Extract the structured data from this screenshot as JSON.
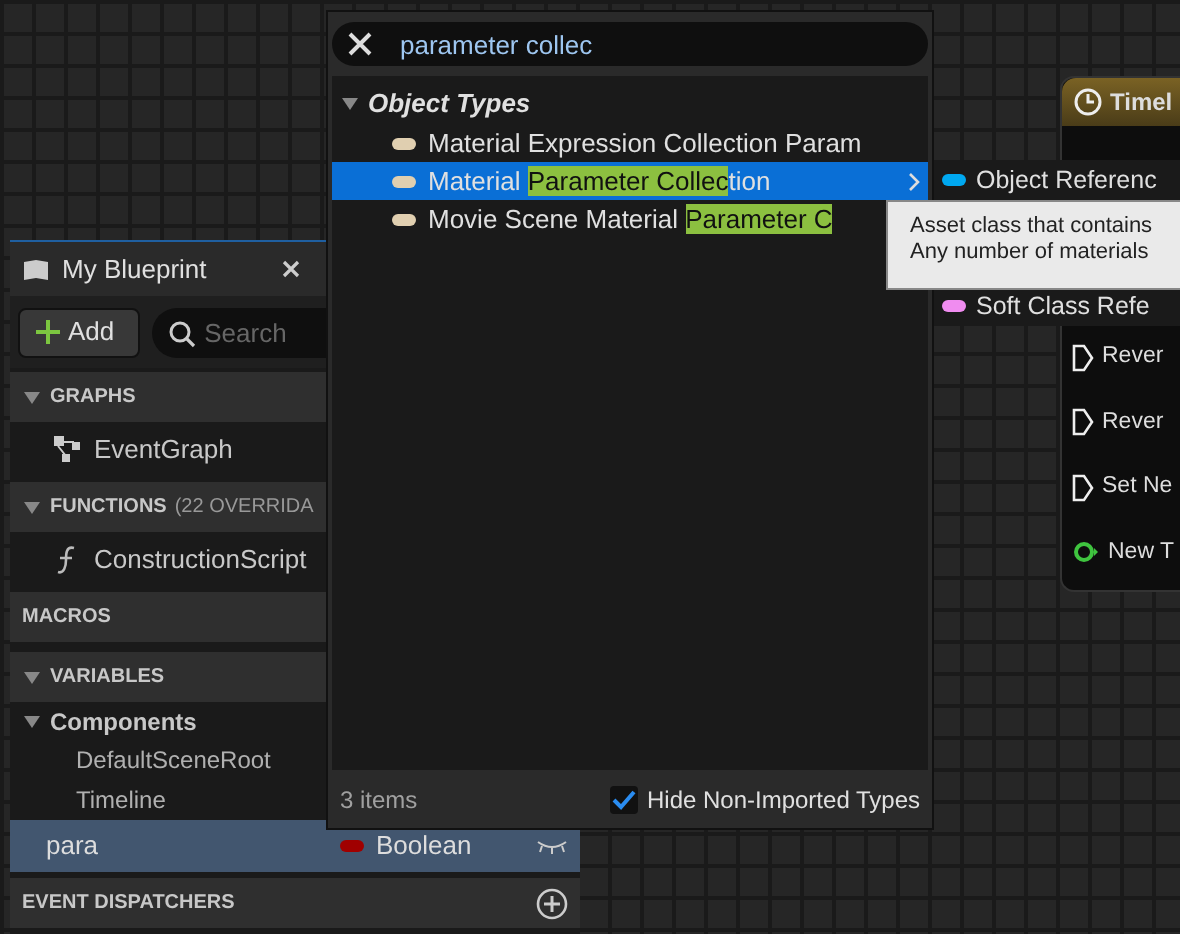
{
  "blueprint_panel": {
    "title": "My Blueprint",
    "add_label": "Add",
    "search": {
      "placeholder": "Search"
    },
    "sections": [
      {
        "label": "GRAPHS",
        "expanded": true,
        "children": [
          {
            "label": "EventGraph",
            "kind": "graph"
          }
        ]
      },
      {
        "label": "FUNCTIONS",
        "note": "(22 OVERRIDA",
        "expanded": true,
        "children": [
          {
            "label": "ConstructionScript",
            "kind": "function"
          }
        ]
      },
      {
        "label": "MACROS"
      },
      {
        "label": "VARIABLES",
        "expanded": true,
        "children": [
          {
            "label": "Components",
            "kind": "group",
            "expanded": true,
            "children": [
              {
                "label": "DefaultSceneRoot",
                "kind": "item"
              },
              {
                "label": "Timeline",
                "kind": "item"
              }
            ]
          },
          {
            "label": "para",
            "kind": "variable",
            "selected": true,
            "type": "Boolean"
          }
        ]
      },
      {
        "label": "EVENT DISPATCHERS",
        "addable": true
      }
    ]
  },
  "timeline_node": {
    "title": "Timel",
    "pins": [
      {
        "label": "Rever",
        "kind": "exec"
      },
      {
        "label": "Rever",
        "kind": "exec"
      },
      {
        "label": "Set Ne",
        "kind": "exec"
      },
      {
        "label": "New T",
        "kind": "data"
      }
    ]
  },
  "type_picker": {
    "search": {
      "value": "parameter collec"
    },
    "category": {
      "label": "Object Types",
      "expanded": true
    },
    "items": [
      {
        "selected": false,
        "submenu": false,
        "segments": [
          {
            "text": "Material Expression Collection Param",
            "match": false
          }
        ]
      },
      {
        "selected": true,
        "submenu": true,
        "segments": [
          {
            "text": "Material ",
            "match": false
          },
          {
            "text": "Parameter Collec",
            "match": true
          },
          {
            "text": "tion",
            "match": false
          }
        ]
      },
      {
        "selected": false,
        "submenu": false,
        "segments": [
          {
            "text": "Movie Scene Material ",
            "match": false
          },
          {
            "text": "Parameter C",
            "match": true
          }
        ]
      }
    ],
    "count": "3 items",
    "hide_non_imported": {
      "label": "Hide Non-Imported Types",
      "checked": true
    }
  },
  "submenu": [
    {
      "label": "Object Referenc",
      "color": "#00a8f0"
    },
    {
      "label": "Soft Class Refe",
      "color": "#f08cf0"
    }
  ],
  "tooltip": [
    "Asset class that contains",
    "Any number of materials"
  ]
}
